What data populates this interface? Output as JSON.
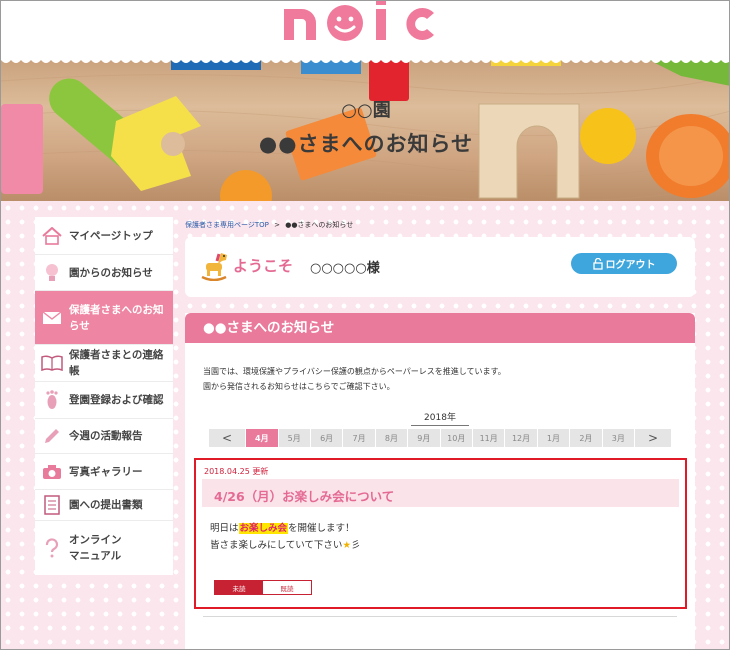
{
  "hero": {
    "subtitle": "○○園",
    "title": "●●さまへのお知らせ"
  },
  "sidebar": {
    "items": [
      {
        "label": "マイページトップ",
        "icon": "house-icon"
      },
      {
        "label": "園からのお知らせ",
        "icon": "lightbulb-icon"
      },
      {
        "label": "保護者さまへのお知らせ",
        "icon": "envelope-icon",
        "active": true
      },
      {
        "label": "保護者さまとの連絡帳",
        "icon": "book-icon"
      },
      {
        "label": "登園登録および確認",
        "icon": "footprint-icon"
      },
      {
        "label": "今週の活動報告",
        "icon": "pencil-icon"
      },
      {
        "label": "写真ギャラリー",
        "icon": "camera-icon"
      },
      {
        "label": "園への提出書類",
        "icon": "document-icon"
      },
      {
        "label": "オンライン\nマニュアル",
        "icon": "question-icon"
      }
    ]
  },
  "breadcrumb": {
    "link": "保護者さま専用ページTOP",
    "separator": ">",
    "current": "●●さまへのお知らせ"
  },
  "welcome": {
    "greeting": "ようこそ",
    "name": "○○○○○様",
    "logout_label": "ログアウト"
  },
  "panel": {
    "title": "●●さまへのお知らせ",
    "intro_line1": "当園では、環境保護やプライバシー保護の観点からペーパーレスを推進しています。",
    "intro_line2": "園から発信されるお知らせはこちらでご確認下さい。"
  },
  "calendar": {
    "year": "2018年",
    "prev": "<",
    "next": ">",
    "months": [
      "4月",
      "5月",
      "6月",
      "7月",
      "8月",
      "9月",
      "10月",
      "11月",
      "12月",
      "1月",
      "2月",
      "3月"
    ],
    "active_month": "4月"
  },
  "notice": {
    "date": "2018.04.25 更新",
    "title": "4/26（月）お楽しみ会について",
    "body_prefix": "明日は",
    "body_highlight": "お楽しみ会",
    "body_suffix": "を開催します！",
    "body_line2": "皆さま楽しみにしていて下さい",
    "body_line2_end": "彡",
    "unread_label": "未読",
    "read_label": "既読"
  },
  "colors": {
    "accent_pink": "#ea7a9c",
    "logout_blue": "#3ea6dc",
    "highlight_border": "#e01a26"
  }
}
